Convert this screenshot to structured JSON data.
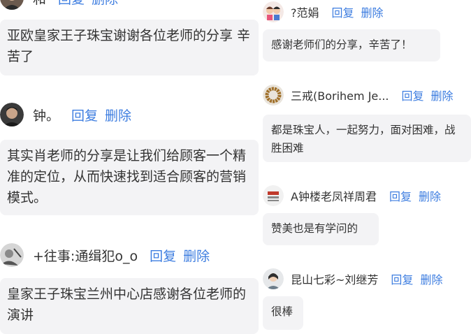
{
  "left_comments": [
    {
      "author": "和",
      "reply": "回复",
      "delete": "删除",
      "avatar_icon": "man-portrait-icon",
      "text": "亚欧皇家王子珠宝谢谢各位老师的分享 辛苦了"
    },
    {
      "author": "钟。",
      "reply": "回复",
      "delete": "删除",
      "avatar_icon": "man-portrait-icon",
      "text": "其实肖老师的分享是让我们给顾客一个精准的定位，从而快速找到适合顾客的营销模式。"
    },
    {
      "author": "+往事:通缉犯o_o",
      "reply": "回复",
      "delete": "删除",
      "avatar_icon": "sketch-portrait-icon",
      "text": "皇家王子珠宝兰州中心店感谢各位老师的演讲"
    }
  ],
  "right_comments": [
    {
      "author": "?范娟",
      "reply": "回复",
      "delete": "删除",
      "avatar_icon": "cartoon-couple-icon",
      "text": "感谢老师们的分享，辛苦了！"
    },
    {
      "author": "三戒(Borihem Je...",
      "reply": "回复",
      "delete": "删除",
      "avatar_icon": "bead-bracelet-icon",
      "text": "都是珠宝人，一起努力，面对困难，战胜困难"
    },
    {
      "author": "A钟楼老凤祥周君",
      "reply": "回复",
      "delete": "删除",
      "avatar_icon": "store-logo-icon",
      "text": "赞美也是有学问的"
    },
    {
      "author": "昆山七彩~刘继芳",
      "reply": "回复",
      "delete": "删除",
      "avatar_icon": "woman-portrait-icon",
      "text": "很棒"
    }
  ],
  "colors": {
    "link": "#3d7de0",
    "bubble": "#f3f3f5",
    "text": "#333333"
  }
}
